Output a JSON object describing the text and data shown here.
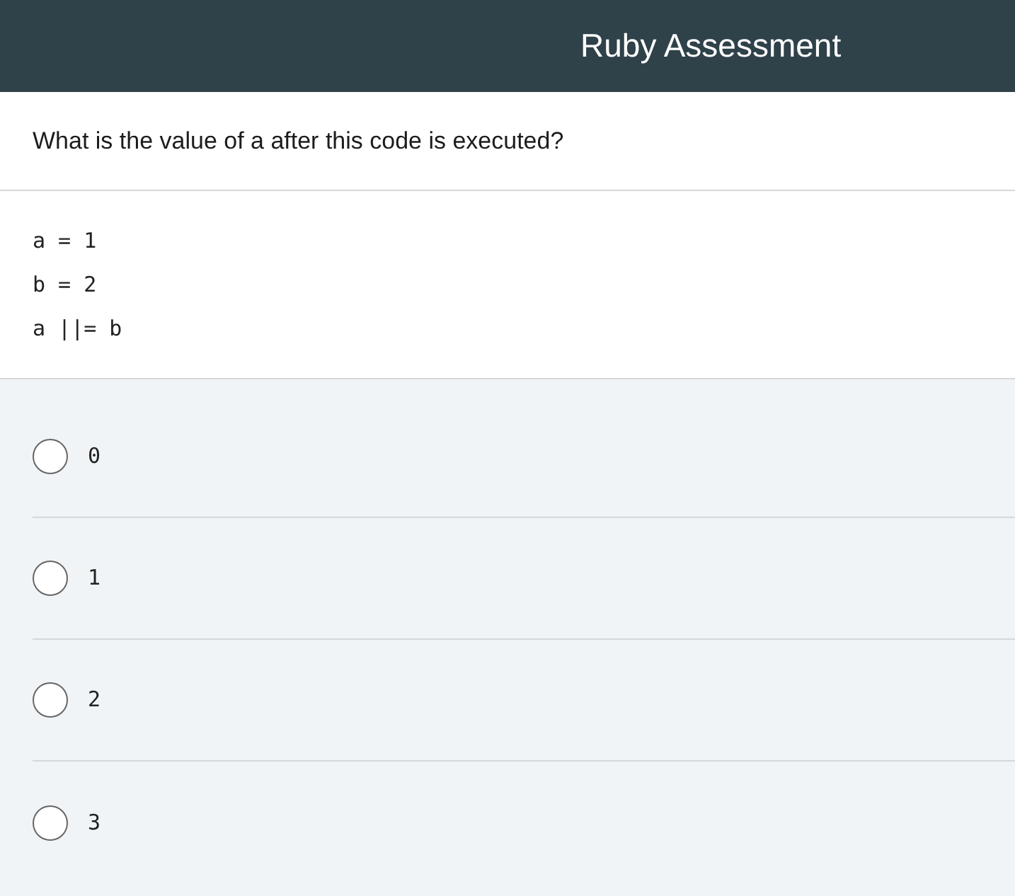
{
  "header": {
    "title": "Ruby Assessment"
  },
  "question": {
    "text": "What is the value of a after this code is executed?"
  },
  "code_lines": [
    "a = 1",
    "b = 2",
    "a ||= b"
  ],
  "options": [
    {
      "label": "0",
      "selected": false
    },
    {
      "label": "1",
      "selected": false
    },
    {
      "label": "2",
      "selected": false
    },
    {
      "label": "3",
      "selected": false
    }
  ]
}
